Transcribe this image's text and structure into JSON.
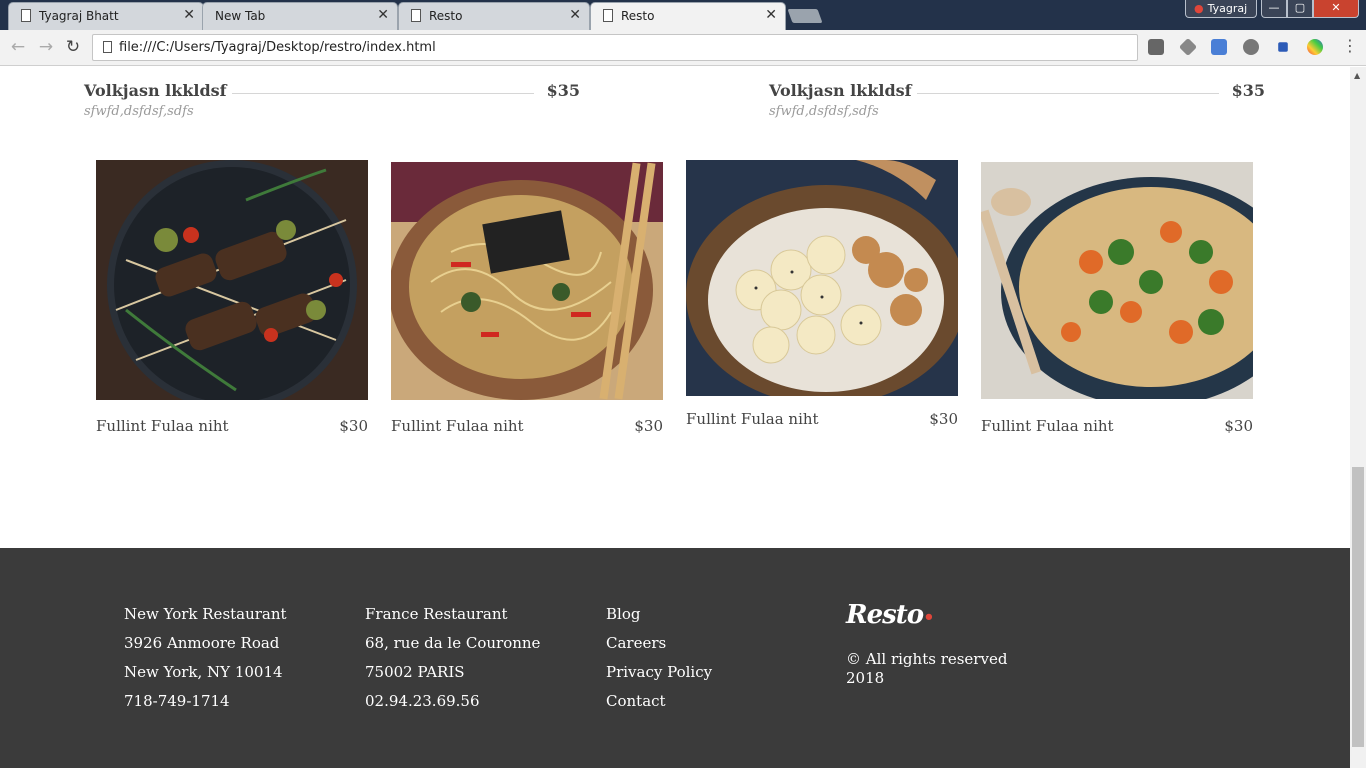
{
  "browser": {
    "tabs": [
      {
        "title": "Tyagraj Bhatt",
        "close": "✕"
      },
      {
        "title": "New Tab",
        "close": "✕"
      },
      {
        "title": "Resto",
        "close": "✕"
      },
      {
        "title": "Resto",
        "close": "✕"
      }
    ],
    "profile_name": "Tyagraj",
    "url": "file:///C:/Users/Tyagraj/Desktop/restro/index.html"
  },
  "menu_items": [
    {
      "name": "Volkjasn lkkldsf",
      "price": "$35",
      "description": "sfwfd,dsfdsf,sdfs"
    },
    {
      "name": "Volkjasn lkkldsf",
      "price": "$35",
      "description": "sfwfd,dsfdsf,sdfs"
    }
  ],
  "dishes": [
    {
      "name": "Fullint Fulaa niht",
      "price": "$30",
      "photo": "skewers-icon"
    },
    {
      "name": "Fullint Fulaa niht",
      "price": "$30",
      "photo": "noodles-bowl-icon"
    },
    {
      "name": "Fullint Fulaa niht",
      "price": "$30",
      "photo": "banana-oat-bowl-icon"
    },
    {
      "name": "Fullint Fulaa niht",
      "price": "$30",
      "photo": "quinoa-pan-icon"
    }
  ],
  "footer": {
    "new_york": [
      "New York Restaurant",
      "3926 Anmoore Road",
      "New York, NY 10014",
      "718-749-1714"
    ],
    "france": [
      "France Restaurant",
      "68, rue da le Couronne",
      "75002 PARIS",
      "02.94.23.69.56"
    ],
    "links": [
      "Blog",
      "Careers",
      "Privacy Policy",
      "Contact"
    ],
    "logo": "Resto",
    "rights": "© All rights reserved 2018"
  },
  "colors": {
    "footer_bg": "#3b3b3b",
    "accent": "#e0463a"
  }
}
